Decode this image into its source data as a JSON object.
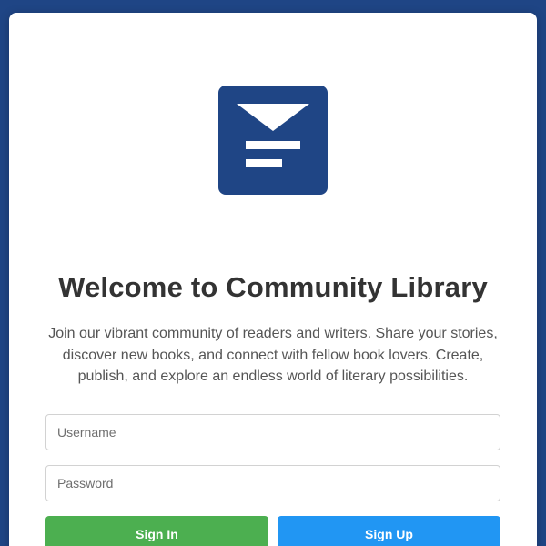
{
  "page": {
    "title": "Welcome to Community Library",
    "description": "Join our vibrant community of readers and writers. Share your stories, discover new books, and connect with fellow book lovers. Create, publish, and explore an endless world of literary possibilities."
  },
  "logo": {
    "icon": "library-logo-icon",
    "color": "#1f4585"
  },
  "form": {
    "username_placeholder": "Username",
    "username_value": "",
    "password_placeholder": "Password",
    "password_value": "",
    "signin_label": "Sign In",
    "signup_label": "Sign Up"
  },
  "colors": {
    "background": "#1f4585",
    "signin_button": "#4caf50",
    "signup_button": "#2196f3",
    "title_text": "#333333"
  }
}
